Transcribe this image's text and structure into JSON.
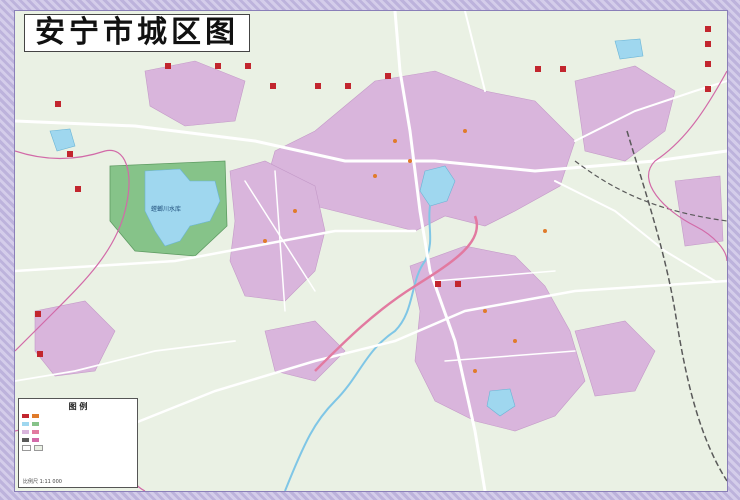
{
  "map": {
    "title": "安宁市城区图",
    "lake_label": "螳螂川水库",
    "colors": {
      "land": "#eaf1e4",
      "urban": "#d9b5dc",
      "water": "#9fd7ef",
      "forest": "#86c389",
      "road": "#ffffff",
      "highway": "#e27aa0",
      "boundary": "#d26aa8",
      "rail": "#5a5a5a",
      "marker": "#c2262e"
    },
    "legend": {
      "title": "图   例",
      "scale": "比例尺 1:11 000"
    }
  }
}
